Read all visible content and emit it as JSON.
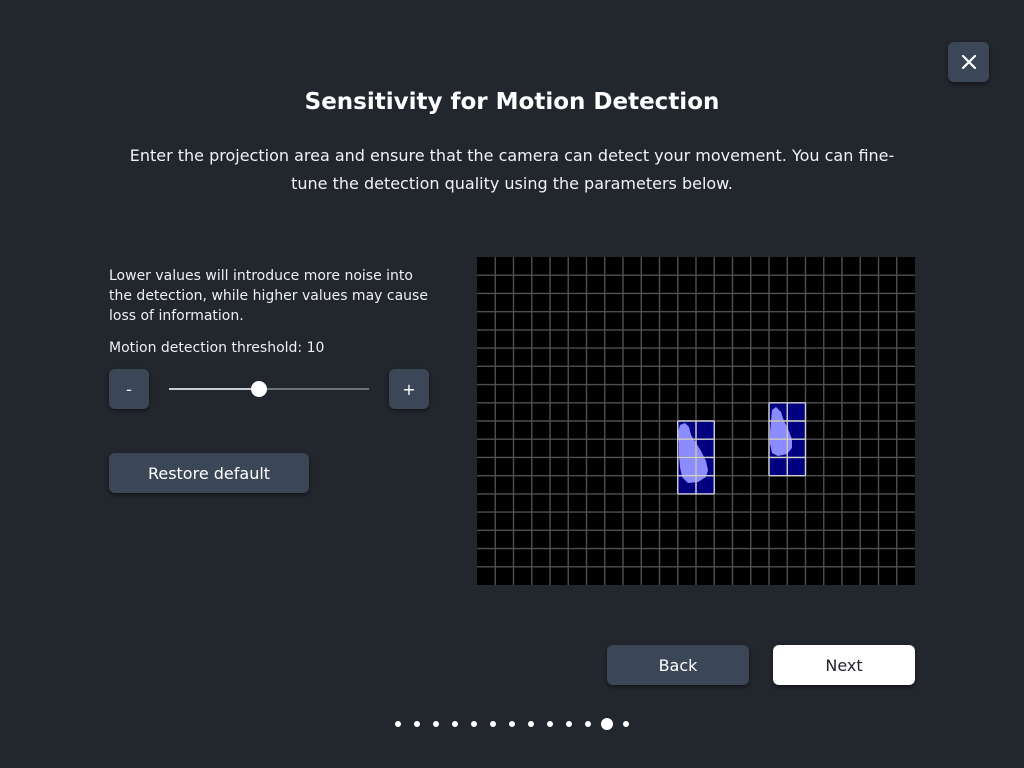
{
  "dialog": {
    "title": "Sensitivity for Motion Detection",
    "description": "Enter the projection area and ensure that the camera can detect your movement. You can fine-tune the detection quality using the parameters below.",
    "close_icon": "close-icon"
  },
  "settings": {
    "help_text": "Lower values will introduce more noise into the detection, while higher values may cause loss of information.",
    "threshold_label": "Motion detection threshold: 10",
    "minus_label": "-",
    "plus_label": "+",
    "slider_fraction": 0.45,
    "restore_label": "Restore default"
  },
  "preview": {
    "grid_columns": 24,
    "grid_rows": 18,
    "grid_line_color": "#4f4f4f",
    "active_cell_color": "#000080",
    "active_grid_line_color": "#d0d0d0",
    "blob_color": "#8a8cff",
    "active_regions": [
      {
        "col": 11,
        "row": 9,
        "cols": 2,
        "rows": 4
      },
      {
        "col": 16,
        "row": 8,
        "cols": 2,
        "rows": 4
      }
    ]
  },
  "navigation": {
    "back_label": "Back",
    "next_label": "Next",
    "total_pages": 13,
    "current_page": 12
  }
}
